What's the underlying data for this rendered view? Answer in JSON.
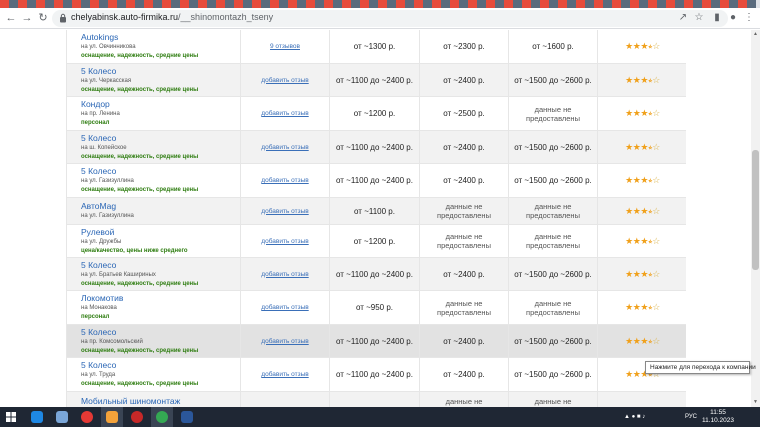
{
  "browser": {
    "url_host": "chelyabinsk.auto-firmika.ru",
    "url_path": "/__shinomontazh_tseny"
  },
  "rows": [
    {
      "name": "Autokings",
      "addr": "на ул. Овчинникова",
      "tags": "оснащение, надежность, средние цены",
      "review": "9 отзывов",
      "p1": "от ~1300 р.",
      "p2": "от ~2300 р.",
      "p3": "от ~1600 р.",
      "rating": 3.5,
      "style": "plain"
    },
    {
      "name": "5 Колесо",
      "addr": "на ул. Черкасская",
      "tags": "оснащение, надежность, средние цены",
      "review": "добавить отзыв",
      "p1": "от ~1100 до ~2400 р.",
      "p2": "от ~2400 р.",
      "p3": "от ~1500 до ~2600 р.",
      "rating": 3.5,
      "style": "alt"
    },
    {
      "name": "Кондор",
      "addr": "на пр. Ленина",
      "tags": "персонал",
      "review": "добавить отзыв",
      "p1": "от ~1200 р.",
      "p2": "от ~2500 р.",
      "p3": "данные не предоставлены",
      "rating": 3.5,
      "style": "plain"
    },
    {
      "name": "5 Колесо",
      "addr": "на ш. Копейское",
      "tags": "оснащение, надежность, средние цены",
      "review": "добавить отзыв",
      "p1": "от ~1100 до ~2400 р.",
      "p2": "от ~2400 р.",
      "p3": "от ~1500 до ~2600 р.",
      "rating": 3.5,
      "style": "alt"
    },
    {
      "name": "5 Колесо",
      "addr": "на ул. Газизуллина",
      "tags": "оснащение, надежность, средние цены",
      "review": "добавить отзыв",
      "p1": "от ~1100 до ~2400 р.",
      "p2": "от ~2400 р.",
      "p3": "от ~1500 до ~2600 р.",
      "rating": 3.5,
      "style": "plain"
    },
    {
      "name": "АвтоMag",
      "addr": "на ул. Газизуллина",
      "tags": "",
      "review": "добавить отзыв",
      "p1": "от ~1100 р.",
      "p2": "данные не предоставлены",
      "p3": "данные не предоставлены",
      "rating": 3.5,
      "style": "alt"
    },
    {
      "name": "Рулевой",
      "addr": "на ул. Дружбы",
      "tags": "цена/качество, цены ниже среднего",
      "review": "добавить отзыв",
      "p1": "от ~1200 р.",
      "p2": "данные не предоставлены",
      "p3": "данные не предоставлены",
      "rating": 3.5,
      "style": "plain"
    },
    {
      "name": "5 Колесо",
      "addr": "на ул. Братьев Кашириных",
      "tags": "оснащение, надежность, средние цены",
      "review": "добавить отзыв",
      "p1": "от ~1100 до ~2400 р.",
      "p2": "от ~2400 р.",
      "p3": "от ~1500 до ~2600 р.",
      "rating": 3.5,
      "style": "alt"
    },
    {
      "name": "Локомотив",
      "addr": "на Монакова",
      "tags": "персонал",
      "review": "добавить отзыв",
      "p1": "от ~950 р.",
      "p2": "данные не предоставлены",
      "p3": "данные не предоставлены",
      "rating": 3.5,
      "style": "plain"
    },
    {
      "name": "5 Колесо",
      "addr": "на пр. Комсомольский",
      "tags": "оснащение, надежность, средние цены",
      "review": "добавить отзыв",
      "p1": "от ~1100 до ~2400 р.",
      "p2": "от ~2400 р.",
      "p3": "от ~1500 до ~2600 р.",
      "rating": 3.5,
      "style": "hl"
    },
    {
      "name": "5 Колесо",
      "addr": "на ул. Труда",
      "tags": "оснащение, надежность, средние цены",
      "review": "добавить отзыв",
      "p1": "от ~1100 до ~2400 р.",
      "p2": "от ~2400 р.",
      "p3": "от ~1500 до ~2600 р.",
      "rating": 3.5,
      "style": "plain"
    },
    {
      "name": "Мобильный шиномонтаж",
      "addr": "",
      "tags": "",
      "review": "",
      "p1": "",
      "p2": "данные не",
      "p3": "данные не",
      "rating": null,
      "style": "alt"
    }
  ],
  "tooltip": "Нажмите для перехода к компании",
  "taskbar": {
    "lang": "РУС",
    "time": "11:55",
    "date": "11.10.2023"
  }
}
